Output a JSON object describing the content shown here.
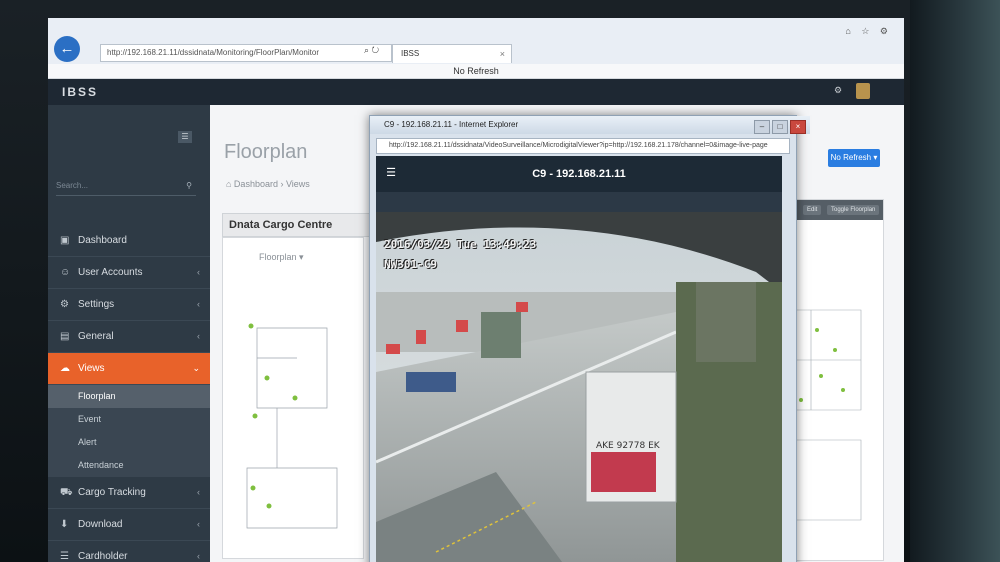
{
  "browser": {
    "address": "http://192.168.21.11/dssidnata/Monitoring/FloorPlan/Monitor",
    "addr_icons": "⌕ ↻",
    "tab_label": "IBSS",
    "tab_close": "×",
    "window_icons": "⌂ ☆ ⚙",
    "status_bar": "No Refresh"
  },
  "app": {
    "brand": "IBSS"
  },
  "sidebar": {
    "toggle": "☰",
    "search_placeholder": "Search...",
    "items": [
      {
        "label": "Dashboard",
        "icon": "▣"
      },
      {
        "label": "User Accounts",
        "icon": "☺",
        "chevron": "‹"
      },
      {
        "label": "Settings",
        "icon": "⚙",
        "chevron": "‹"
      },
      {
        "label": "General",
        "icon": "▤",
        "chevron": "‹"
      },
      {
        "label": "Views",
        "icon": "☁",
        "chevron": "⌄"
      }
    ],
    "sub_items": [
      "Floorplan",
      "Event",
      "Alert",
      "Attendance"
    ],
    "items_after": [
      {
        "label": "Cargo Tracking",
        "icon": "⛟",
        "chevron": "‹"
      },
      {
        "label": "Download",
        "icon": "⬇",
        "chevron": "‹"
      },
      {
        "label": "Cardholder",
        "icon": "☰",
        "chevron": "‹"
      }
    ]
  },
  "content": {
    "page_title": "Floorplan",
    "breadcrumb": "⌂ Dashboard › Views",
    "panel_title": "Dnata Cargo Centre",
    "floorplan_select": "Floorplan ▾",
    "no_refresh_button": "No Refresh ▾",
    "right_panel_buttons": [
      "Edit",
      "Toggle Floorplan"
    ]
  },
  "popup": {
    "window_title": "C9 - 192.168.21.11 - Internet Explorer",
    "controls": [
      "–",
      "□",
      "×"
    ],
    "url": "http://192.168.21.11/dssidnata/VideoSurveillance/MicrodigitalViewer?ip=http://192.168.21.178/channel=0&image-live-page",
    "camera_title": "C9 - 192.168.21.11",
    "menu_icon": "☰",
    "osd_datetime": "2016/03/29 Tue 13:49:23",
    "osd_camera": "NW301-C9",
    "container_id": "AKE 92778 EK"
  }
}
